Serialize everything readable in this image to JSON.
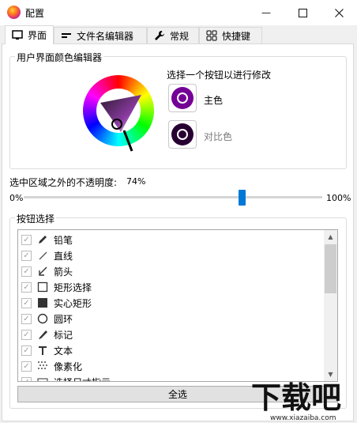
{
  "window": {
    "title": "配置",
    "minimize_glyph": "—",
    "maximize_glyph": "☐",
    "close_glyph": "✕"
  },
  "tabs": [
    {
      "label": "界面",
      "icon": "monitor-icon",
      "active": true
    },
    {
      "label": "文件名编辑器",
      "icon": "text-edit-icon",
      "active": false
    },
    {
      "label": "常规",
      "icon": "wrench-icon",
      "active": false
    },
    {
      "label": "快捷键",
      "icon": "grid-icon",
      "active": false
    }
  ],
  "color_editor": {
    "title": "用户界面颜色编辑器",
    "instruction": "选择一个按钮以进行修改",
    "primary_label": "主色",
    "contrast_label": "对比色",
    "primary_color": "#740096",
    "contrast_color": "#270032"
  },
  "opacity": {
    "label": "选中区域之外的不透明度:",
    "value": "74%",
    "min_label": "0%",
    "max_label": "100%",
    "level": 0.74,
    "accent": "#0078d7"
  },
  "buttons": {
    "title": "按钮选择",
    "items": [
      {
        "label": "铅笔",
        "icon": "pencil-icon",
        "checked": true
      },
      {
        "label": "直线",
        "icon": "line-icon",
        "checked": true
      },
      {
        "label": "箭头",
        "icon": "arrow-icon",
        "checked": true
      },
      {
        "label": "矩形选择",
        "icon": "rectangle-outline-icon",
        "checked": true
      },
      {
        "label": "实心矩形",
        "icon": "rectangle-filled-icon",
        "checked": true
      },
      {
        "label": "圆环",
        "icon": "circle-icon",
        "checked": true
      },
      {
        "label": "标记",
        "icon": "marker-icon",
        "checked": true
      },
      {
        "label": "文本",
        "icon": "text-icon",
        "checked": true
      },
      {
        "label": "像素化",
        "icon": "pixelate-icon",
        "checked": true
      },
      {
        "label": "选择尺寸指示",
        "icon": "size-indicator-icon",
        "checked": true
      }
    ],
    "select_all": "全选"
  },
  "watermark": {
    "brand": "下载吧",
    "url": "www.xiazaiba.com"
  }
}
